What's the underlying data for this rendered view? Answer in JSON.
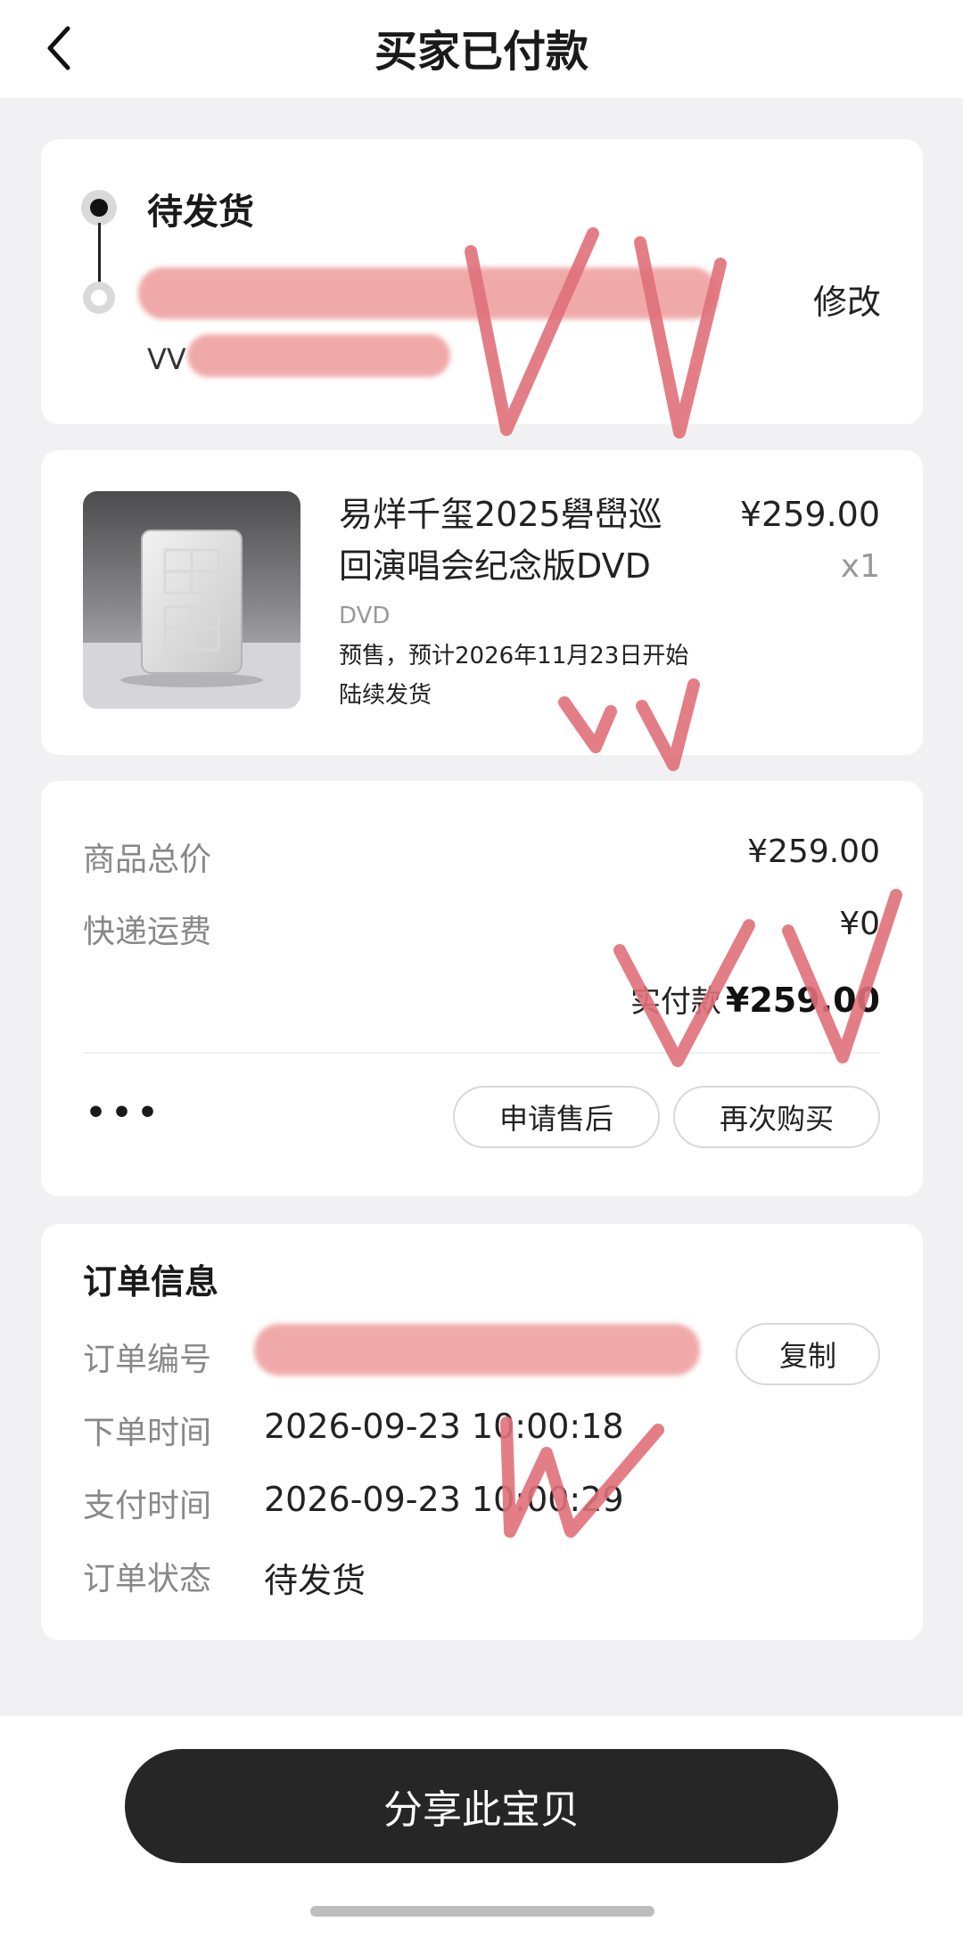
{
  "header": {
    "title": "买家已付款"
  },
  "status_card": {
    "status": "待发货",
    "modify_label": "修改",
    "name_prefix": "VV"
  },
  "product": {
    "name": "易烊千玺2025礐嶨巡回演唱会纪念版DVD",
    "price": "¥259.00",
    "quantity": "x1",
    "tag": "DVD",
    "note": "预售，预计2026年11月23日开始陆续发货"
  },
  "pricing": {
    "goods_total_label": "商品总价",
    "goods_total_value": "¥259.00",
    "shipping_label": "快递运费",
    "shipping_value": "¥0",
    "paid_label": "实付款",
    "paid_value": "¥259.00",
    "more_label": "•••",
    "after_sale_button": "申请售后",
    "buy_again_button": "再次购买"
  },
  "order_info": {
    "title": "订单信息",
    "order_no_label": "订单编号",
    "copy_button": "复制",
    "order_time_label": "下单时间",
    "order_time_value": "2026-09-23 10:00:18",
    "pay_time_label": "支付时间",
    "pay_time_value": "2026-09-23 10:00:29",
    "order_status_label": "订单状态",
    "order_status_value": "待发货"
  },
  "bottom": {
    "share_button": "分享此宝贝"
  },
  "colors": {
    "scribble": "#e0707a",
    "redaction": "#f0a9a9",
    "primary_button": "#262626"
  },
  "icons": {
    "back": "chevron-left-icon"
  }
}
